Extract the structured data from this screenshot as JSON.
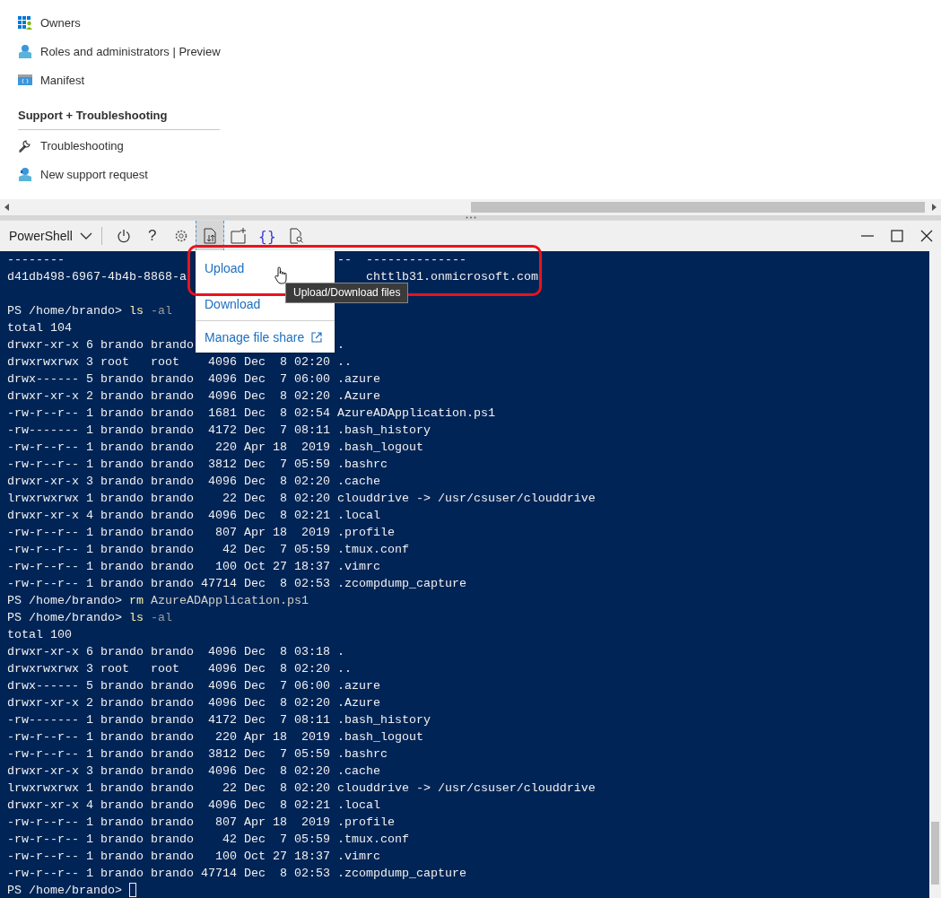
{
  "sidebar": {
    "items": [
      {
        "kind": "owners",
        "label": "Owners"
      },
      {
        "kind": "roles",
        "label": "Roles and administrators | Preview"
      },
      {
        "kind": "manifest",
        "label": "Manifest"
      }
    ],
    "section": {
      "title": "Support + Troubleshooting",
      "items": [
        {
          "kind": "wrench",
          "label": "Troubleshooting"
        },
        {
          "kind": "support",
          "label": "New support request"
        }
      ]
    }
  },
  "shell_toolbar": {
    "shell": "PowerShell",
    "tools": [
      {
        "kind": "power",
        "selected": false
      },
      {
        "kind": "help",
        "label": "?",
        "selected": false
      },
      {
        "kind": "settings",
        "selected": false
      },
      {
        "kind": "upload-download",
        "selected": true
      },
      {
        "kind": "new-file",
        "selected": false
      },
      {
        "kind": "braces",
        "label": "{}",
        "selected": false
      },
      {
        "kind": "file-search",
        "selected": false
      }
    ]
  },
  "file_menu": {
    "items": [
      {
        "kind": "item",
        "label": "Upload"
      },
      {
        "kind": "item",
        "label": "Download"
      },
      {
        "kind": "external",
        "label": "Manage file share"
      }
    ],
    "tooltip": "Upload/Download files"
  },
  "terminal": {
    "lines": [
      {
        "kind": "text",
        "parts": [
          {
            "segments": [
              {
                "kind": "output",
                "text": "--------"
              }
            ]
          },
          {
            "segments": [
              {
                "kind": "output",
                "text": "                                      --  --------------"
              }
            ]
          }
        ]
      },
      {
        "kind": "text",
        "parts": [
          {
            "segments": [
              {
                "kind": "output",
                "text": "d41db498-6967-4b4b-8868-a"
              }
            ]
          },
          {
            "segments": [
              {
                "kind": "output",
                "text": "                         chttlb31.onmicrosoft.com"
              }
            ]
          }
        ]
      },
      {
        "kind": "blank"
      },
      {
        "kind": "text",
        "segments": [
          {
            "kind": "output",
            "text": "PS /home/brando> "
          },
          {
            "kind": "command",
            "text": "ls"
          },
          {
            "kind": "parameter",
            "text": " -al"
          }
        ]
      },
      {
        "kind": "text",
        "segments": [
          {
            "kind": "output",
            "text": "total 104"
          }
        ]
      },
      {
        "kind": "text",
        "parts": [
          {
            "segments": [
              {
                "kind": "output",
                "text": "drwxr-xr-x 6 brando brando"
              }
            ]
          },
          {
            "segments": [
              {
                "kind": "output",
                "text": "                    ."
              }
            ]
          }
        ]
      },
      {
        "kind": "text",
        "segments": [
          {
            "kind": "output",
            "text": "drwxrwxrwx 3 root   root    4096 Dec  8 02:20 .."
          }
        ]
      },
      {
        "kind": "text",
        "segments": [
          {
            "kind": "output",
            "text": "drwx------ 5 brando brando  4096 Dec  7 06:00 .azure"
          }
        ]
      },
      {
        "kind": "text",
        "segments": [
          {
            "kind": "output",
            "text": "drwxr-xr-x 2 brando brando  4096 Dec  8 02:20 .Azure"
          }
        ]
      },
      {
        "kind": "text",
        "segments": [
          {
            "kind": "output",
            "text": "-rw-r--r-- 1 brando brando  1681 Dec  8 02:54 AzureADApplication.ps1"
          }
        ]
      },
      {
        "kind": "text",
        "segments": [
          {
            "kind": "output",
            "text": "-rw------- 1 brando brando  4172 Dec  7 08:11 .bash_history"
          }
        ]
      },
      {
        "kind": "text",
        "segments": [
          {
            "kind": "output",
            "text": "-rw-r--r-- 1 brando brando   220 Apr 18  2019 .bash_logout"
          }
        ]
      },
      {
        "kind": "text",
        "segments": [
          {
            "kind": "output",
            "text": "-rw-r--r-- 1 brando brando  3812 Dec  7 05:59 .bashrc"
          }
        ]
      },
      {
        "kind": "text",
        "segments": [
          {
            "kind": "output",
            "text": "drwxr-xr-x 3 brando brando  4096 Dec  8 02:20 .cache"
          }
        ]
      },
      {
        "kind": "text",
        "segments": [
          {
            "kind": "output",
            "text": "lrwxrwxrwx 1 brando brando    22 Dec  8 02:20 clouddrive -> /usr/csuser/clouddrive"
          }
        ]
      },
      {
        "kind": "text",
        "segments": [
          {
            "kind": "output",
            "text": "drwxr-xr-x 4 brando brando  4096 Dec  8 02:21 .local"
          }
        ]
      },
      {
        "kind": "text",
        "segments": [
          {
            "kind": "output",
            "text": "-rw-r--r-- 1 brando brando   807 Apr 18  2019 .profile"
          }
        ]
      },
      {
        "kind": "text",
        "segments": [
          {
            "kind": "output",
            "text": "-rw-r--r-- 1 brando brando    42 Dec  7 05:59 .tmux.conf"
          }
        ]
      },
      {
        "kind": "text",
        "segments": [
          {
            "kind": "output",
            "text": "-rw-r--r-- 1 brando brando   100 Oct 27 18:37 .vimrc"
          }
        ]
      },
      {
        "kind": "text",
        "segments": [
          {
            "kind": "output",
            "text": "-rw-r--r-- 1 brando brando 47714 Dec  8 02:53 .zcompdump_capture"
          }
        ]
      },
      {
        "kind": "text",
        "segments": [
          {
            "kind": "output",
            "text": "PS /home/brando> "
          },
          {
            "kind": "command",
            "text": "rm"
          },
          {
            "kind": "argument",
            "text": " AzureADApplication.ps1"
          }
        ]
      },
      {
        "kind": "text",
        "segments": [
          {
            "kind": "output",
            "text": "PS /home/brando> "
          },
          {
            "kind": "command",
            "text": "ls"
          },
          {
            "kind": "parameter",
            "text": " -al"
          }
        ]
      },
      {
        "kind": "text",
        "segments": [
          {
            "kind": "output",
            "text": "total 100"
          }
        ]
      },
      {
        "kind": "text",
        "segments": [
          {
            "kind": "output",
            "text": "drwxr-xr-x 6 brando brando  4096 Dec  8 03:18 ."
          }
        ]
      },
      {
        "kind": "text",
        "segments": [
          {
            "kind": "output",
            "text": "drwxrwxrwx 3 root   root    4096 Dec  8 02:20 .."
          }
        ]
      },
      {
        "kind": "text",
        "segments": [
          {
            "kind": "output",
            "text": "drwx------ 5 brando brando  4096 Dec  7 06:00 .azure"
          }
        ]
      },
      {
        "kind": "text",
        "segments": [
          {
            "kind": "output",
            "text": "drwxr-xr-x 2 brando brando  4096 Dec  8 02:20 .Azure"
          }
        ]
      },
      {
        "kind": "text",
        "segments": [
          {
            "kind": "output",
            "text": "-rw------- 1 brando brando  4172 Dec  7 08:11 .bash_history"
          }
        ]
      },
      {
        "kind": "text",
        "segments": [
          {
            "kind": "output",
            "text": "-rw-r--r-- 1 brando brando   220 Apr 18  2019 .bash_logout"
          }
        ]
      },
      {
        "kind": "text",
        "segments": [
          {
            "kind": "output",
            "text": "-rw-r--r-- 1 brando brando  3812 Dec  7 05:59 .bashrc"
          }
        ]
      },
      {
        "kind": "text",
        "segments": [
          {
            "kind": "output",
            "text": "drwxr-xr-x 3 brando brando  4096 Dec  8 02:20 .cache"
          }
        ]
      },
      {
        "kind": "text",
        "segments": [
          {
            "kind": "output",
            "text": "lrwxrwxrwx 1 brando brando    22 Dec  8 02:20 clouddrive -> /usr/csuser/clouddrive"
          }
        ]
      },
      {
        "kind": "text",
        "segments": [
          {
            "kind": "output",
            "text": "drwxr-xr-x 4 brando brando  4096 Dec  8 02:21 .local"
          }
        ]
      },
      {
        "kind": "text",
        "segments": [
          {
            "kind": "output",
            "text": "-rw-r--r-- 1 brando brando   807 Apr 18  2019 .profile"
          }
        ]
      },
      {
        "kind": "text",
        "segments": [
          {
            "kind": "output",
            "text": "-rw-r--r-- 1 brando brando    42 Dec  7 05:59 .tmux.conf"
          }
        ]
      },
      {
        "kind": "text",
        "segments": [
          {
            "kind": "output",
            "text": "-rw-r--r-- 1 brando brando   100 Oct 27 18:37 .vimrc"
          }
        ]
      },
      {
        "kind": "text",
        "segments": [
          {
            "kind": "output",
            "text": "-rw-r--r-- 1 brando brando 47714 Dec  8 02:53 .zcompdump_capture"
          }
        ]
      },
      {
        "kind": "text",
        "segments": [
          {
            "kind": "output",
            "text": "PS /home/brando> "
          },
          {
            "kind": "cursor"
          }
        ]
      }
    ]
  }
}
